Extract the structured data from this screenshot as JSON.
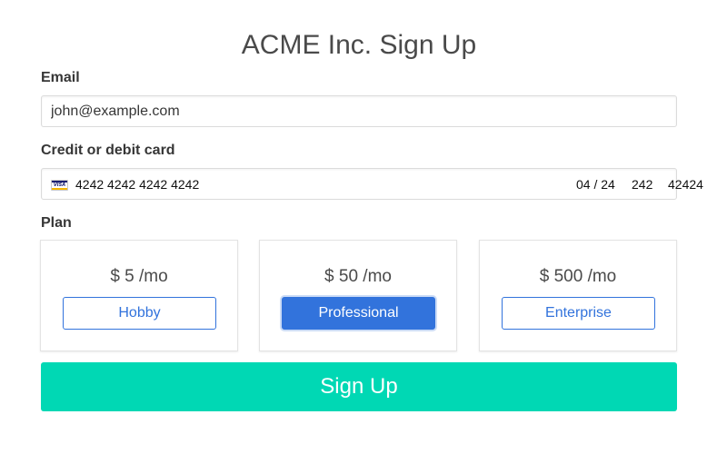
{
  "form": {
    "title": "ACME Inc. Sign Up",
    "email": {
      "label": "Email",
      "value": "john@example.com"
    },
    "card": {
      "label": "Credit or debit card",
      "brand_icon": "visa-icon",
      "brand_text": "VISA",
      "number": "4242 4242 4242 4242",
      "expiry": "04 / 24",
      "cvc": "242",
      "zip": "42424"
    },
    "plan": {
      "label": "Plan",
      "selected": "Professional",
      "options": [
        {
          "price": "$ 5 /mo",
          "name": "Hobby"
        },
        {
          "price": "$ 50 /mo",
          "name": "Professional"
        },
        {
          "price": "$ 500 /mo",
          "name": "Enterprise"
        }
      ]
    },
    "submit_label": "Sign Up"
  },
  "colors": {
    "accent": "#3273dc",
    "submit": "#00d8b4",
    "text": "#4a4a4a"
  }
}
